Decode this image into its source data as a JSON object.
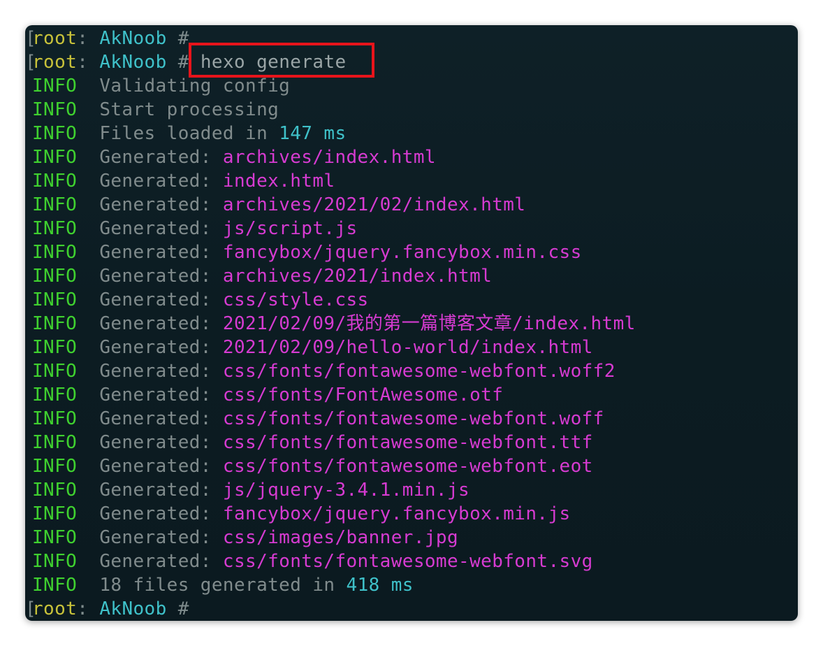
{
  "prompt": {
    "user": "root",
    "colon": ":",
    "host": "AkNoob",
    "hash": "#",
    "bracket": "["
  },
  "command": "hexo generate",
  "colors": {
    "prompt_user": "#c8c23a",
    "prompt_host": "#3fc1c9",
    "level": "#3fd12f",
    "path": "#d63bd1",
    "number": "#3fc1c9",
    "highlight": "#e8141b"
  },
  "log": [
    {
      "level": "INFO",
      "text": "Validating config"
    },
    {
      "level": "INFO",
      "text": "Start processing"
    },
    {
      "level": "INFO",
      "text": "Files loaded in ",
      "num": "147 ms"
    },
    {
      "level": "INFO",
      "text": "Generated: ",
      "path": "archives/index.html"
    },
    {
      "level": "INFO",
      "text": "Generated: ",
      "path": "index.html"
    },
    {
      "level": "INFO",
      "text": "Generated: ",
      "path": "archives/2021/02/index.html"
    },
    {
      "level": "INFO",
      "text": "Generated: ",
      "path": "js/script.js"
    },
    {
      "level": "INFO",
      "text": "Generated: ",
      "path": "fancybox/jquery.fancybox.min.css"
    },
    {
      "level": "INFO",
      "text": "Generated: ",
      "path": "archives/2021/index.html"
    },
    {
      "level": "INFO",
      "text": "Generated: ",
      "path": "css/style.css"
    },
    {
      "level": "INFO",
      "text": "Generated: ",
      "path": "2021/02/09/我的第一篇博客文章/index.html"
    },
    {
      "level": "INFO",
      "text": "Generated: ",
      "path": "2021/02/09/hello-world/index.html"
    },
    {
      "level": "INFO",
      "text": "Generated: ",
      "path": "css/fonts/fontawesome-webfont.woff2"
    },
    {
      "level": "INFO",
      "text": "Generated: ",
      "path": "css/fonts/FontAwesome.otf"
    },
    {
      "level": "INFO",
      "text": "Generated: ",
      "path": "css/fonts/fontawesome-webfont.woff"
    },
    {
      "level": "INFO",
      "text": "Generated: ",
      "path": "css/fonts/fontawesome-webfont.ttf"
    },
    {
      "level": "INFO",
      "text": "Generated: ",
      "path": "css/fonts/fontawesome-webfont.eot"
    },
    {
      "level": "INFO",
      "text": "Generated: ",
      "path": "js/jquery-3.4.1.min.js"
    },
    {
      "level": "INFO",
      "text": "Generated: ",
      "path": "fancybox/jquery.fancybox.min.js"
    },
    {
      "level": "INFO",
      "text": "Generated: ",
      "path": "css/images/banner.jpg"
    },
    {
      "level": "INFO",
      "text": "Generated: ",
      "path": "css/fonts/fontawesome-webfont.svg"
    },
    {
      "level": "INFO",
      "text": "18 files generated in ",
      "num": "418 ms"
    }
  ]
}
